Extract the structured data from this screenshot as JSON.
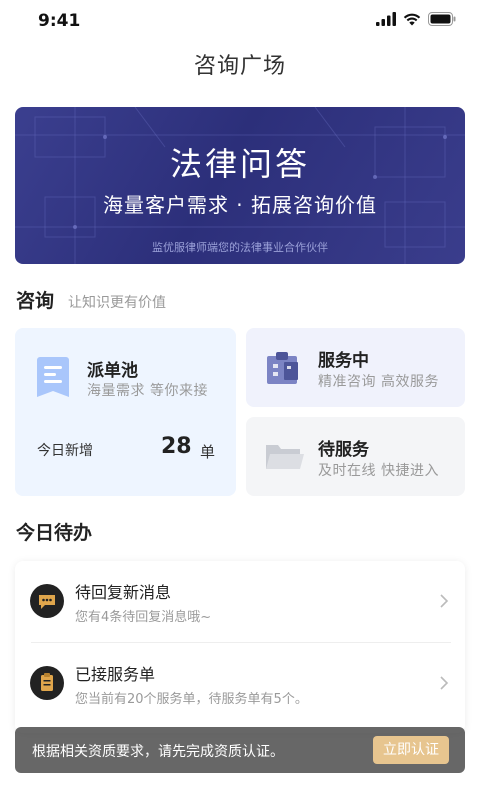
{
  "status_bar": {
    "time": "9:41",
    "icons": [
      "signal-icon",
      "wifi-icon",
      "battery-icon"
    ]
  },
  "nav": {
    "title": "咨询广场"
  },
  "banner": {
    "title": "法律问答",
    "subtitle": "海量客户需求 · 拓展咨询价值",
    "footer": "监优服律师端您的法律事业合作伙伴"
  },
  "consult_section": {
    "heading": "咨询",
    "subheading": "让知识更有价值"
  },
  "pool_card": {
    "title": "派单池",
    "subtitle": "海量需求  等你来接",
    "today_label": "今日新增",
    "today_count": "28",
    "unit": "单",
    "icon": "document-list-icon"
  },
  "serving_card": {
    "title": "服务中",
    "subtitle": "精准咨询  高效服务",
    "icon": "clipboard-icon"
  },
  "waiting_card": {
    "title": "待服务",
    "subtitle": "及时在线  快捷进入",
    "icon": "folder-icon"
  },
  "todo_section": {
    "heading": "今日待办",
    "items": [
      {
        "title": "待回复新消息",
        "subtitle": "您有4条待回复消息哦~",
        "icon": "chat-bubble-icon"
      },
      {
        "title": "已接服务单",
        "subtitle": "您当前有20个服务单，待服务单有5个。",
        "icon": "order-icon"
      }
    ]
  },
  "toast": {
    "text": "根据相关资质要求，请先完成资质认证。",
    "button": "立即认证"
  },
  "colors": {
    "banner": "#2c2f7a",
    "accent_gold": "#e7c58f",
    "pool_bg": "#eef5ff"
  }
}
